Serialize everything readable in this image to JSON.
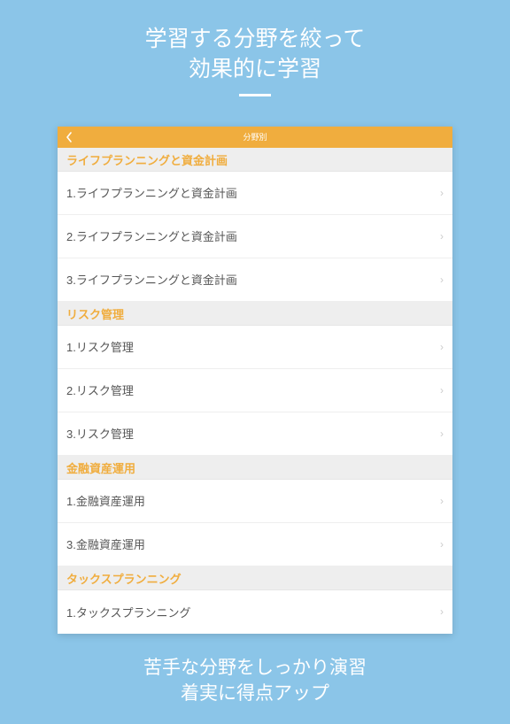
{
  "hero": {
    "top_line1": "学習する分野を絞って",
    "top_line2": "効果的に学習",
    "bottom_line1": "苦手な分野をしっかり演習",
    "bottom_line2": "着実に得点アップ"
  },
  "nav": {
    "title": "分野別"
  },
  "sections": [
    {
      "header": "ライフプランニングと資金計画",
      "items": [
        {
          "label": "1.ライフプランニングと資金計画"
        },
        {
          "label": "2.ライフプランニングと資金計画"
        },
        {
          "label": "3.ライフプランニングと資金計画"
        }
      ]
    },
    {
      "header": "リスク管理",
      "items": [
        {
          "label": "1.リスク管理"
        },
        {
          "label": "2.リスク管理"
        },
        {
          "label": "3.リスク管理"
        }
      ]
    },
    {
      "header": "金融資産運用",
      "items": [
        {
          "label": "1.金融資産運用"
        },
        {
          "label": "3.金融資産運用"
        }
      ]
    },
    {
      "header": "タックスプランニング",
      "items": [
        {
          "label": "1.タックスプランニング"
        }
      ]
    }
  ]
}
